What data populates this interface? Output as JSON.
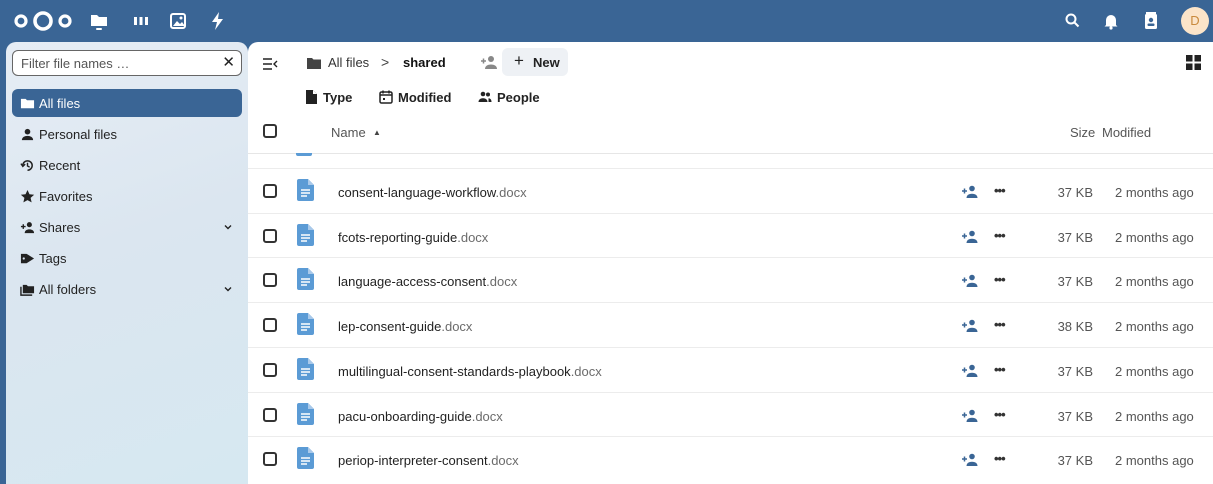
{
  "colors": {
    "header": "#3a6595",
    "accent": "#3a6595",
    "file_icon": "#5b9bd5"
  },
  "sidebar": {
    "filter_placeholder": "Filter file names …",
    "items": [
      {
        "label": "All files",
        "icon": "folder-icon",
        "active": true
      },
      {
        "label": "Personal files",
        "icon": "person-icon"
      },
      {
        "label": "Recent",
        "icon": "history-icon"
      },
      {
        "label": "Favorites",
        "icon": "star-icon"
      },
      {
        "label": "Shares",
        "icon": "share-icon",
        "expandable": true
      },
      {
        "label": "Tags",
        "icon": "tag-icon"
      },
      {
        "label": "All folders",
        "icon": "folders-icon",
        "expandable": true
      }
    ]
  },
  "header": {
    "avatar_initial": "D"
  },
  "breadcrumb": {
    "root": "All files",
    "separator": ">",
    "current": "shared"
  },
  "toolbar": {
    "new_plus": "+",
    "new_label": "New"
  },
  "filters": [
    "Type",
    "Modified",
    "People"
  ],
  "table": {
    "columns": {
      "name": "Name",
      "sort_indicator": "▲",
      "size": "Size",
      "modified": "Modified"
    },
    "rows": [
      {
        "base": "consent-language-workflow",
        "ext": ".docx",
        "size": "37 KB",
        "modified": "2 months ago"
      },
      {
        "base": "fcots-reporting-guide",
        "ext": ".docx",
        "size": "37 KB",
        "modified": "2 months ago"
      },
      {
        "base": "language-access-consent",
        "ext": ".docx",
        "size": "37 KB",
        "modified": "2 months ago"
      },
      {
        "base": "lep-consent-guide",
        "ext": ".docx",
        "size": "38 KB",
        "modified": "2 months ago"
      },
      {
        "base": "multilingual-consent-standards-playbook",
        "ext": ".docx",
        "size": "37 KB",
        "modified": "2 months ago"
      },
      {
        "base": "pacu-onboarding-guide",
        "ext": ".docx",
        "size": "37 KB",
        "modified": "2 months ago"
      },
      {
        "base": "periop-interpreter-consent",
        "ext": ".docx",
        "size": "37 KB",
        "modified": "2 months ago"
      }
    ],
    "more_glyph": "•••"
  }
}
